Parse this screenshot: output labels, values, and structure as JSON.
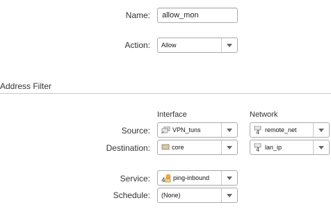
{
  "form": {
    "name_label": "Name:",
    "name_value": "allow_mon",
    "action_label": "Action:",
    "action_value": "Allow"
  },
  "address_filter": {
    "title": "Address Filter",
    "col_interface": "Interface",
    "col_network": "Network",
    "source_label": "Source:",
    "destination_label": "Destination:",
    "source_interface": {
      "value": "VPN_tuns",
      "icon": "vpn-tunnels-icon"
    },
    "source_network": {
      "value": "remote_net",
      "icon": "network-object-icon"
    },
    "destination_interface": {
      "value": "core",
      "icon": "interface-icon"
    },
    "destination_network": {
      "value": "lan_ip",
      "icon": "network-object-icon"
    }
  },
  "service": {
    "service_label": "Service:",
    "service_value": "ping-inbound",
    "service_icon": "service-icon",
    "schedule_label": "Schedule:",
    "schedule_value": "(None)"
  }
}
